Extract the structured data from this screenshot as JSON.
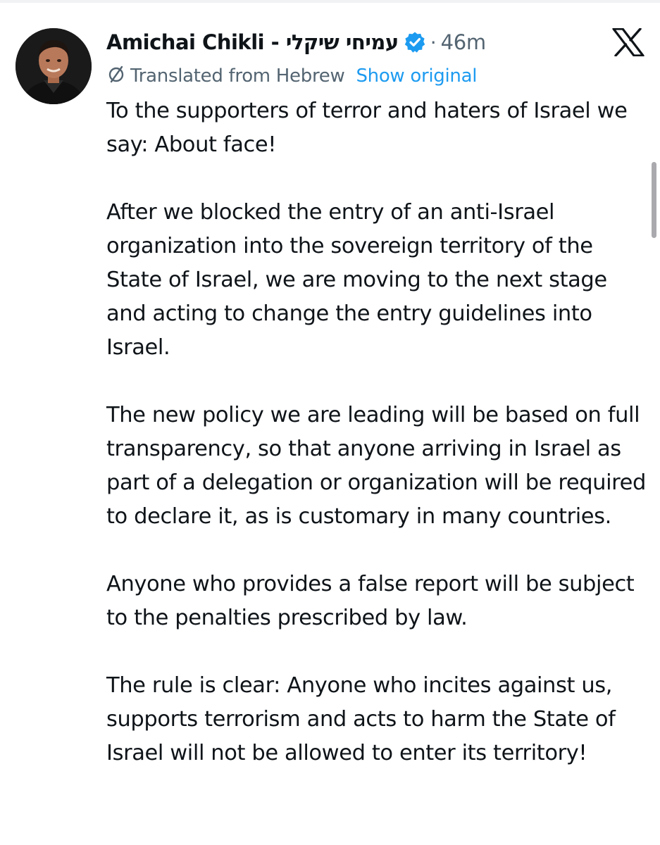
{
  "post": {
    "author": {
      "display_name": "Amichai Chikli - עמיחי שיקלי",
      "verified_icon": "verified-badge-icon",
      "avatar_icon": "avatar"
    },
    "timestamp": "46m",
    "separator": "·",
    "platform_icon": "x-logo-icon",
    "translation": {
      "icon": "translate-icon",
      "label": "Translated from Hebrew",
      "link": "Show original"
    },
    "paragraphs": [
      "To the supporters of terror and haters of Israel we say: About face!",
      "After we blocked the entry of an anti-Israel organization into the sovereign territory of the State of Israel, we are moving to the next stage and acting to change the entry guidelines into Israel.",
      "The new policy we are leading will be based on full transparency, so that anyone arriving in Israel as part of a delegation or organization will be required to declare it, as is customary in many countries.",
      "Anyone who provides a false report will be subject to the penalties prescribed by law.",
      "The rule is clear: Anyone who incites against us, supports terrorism and acts to harm the State of Israel will not be allowed to enter its territory!"
    ]
  },
  "colors": {
    "text": "#0f1419",
    "secondary": "#536471",
    "link": "#1d9bf0",
    "verified": "#1d9bf0"
  }
}
